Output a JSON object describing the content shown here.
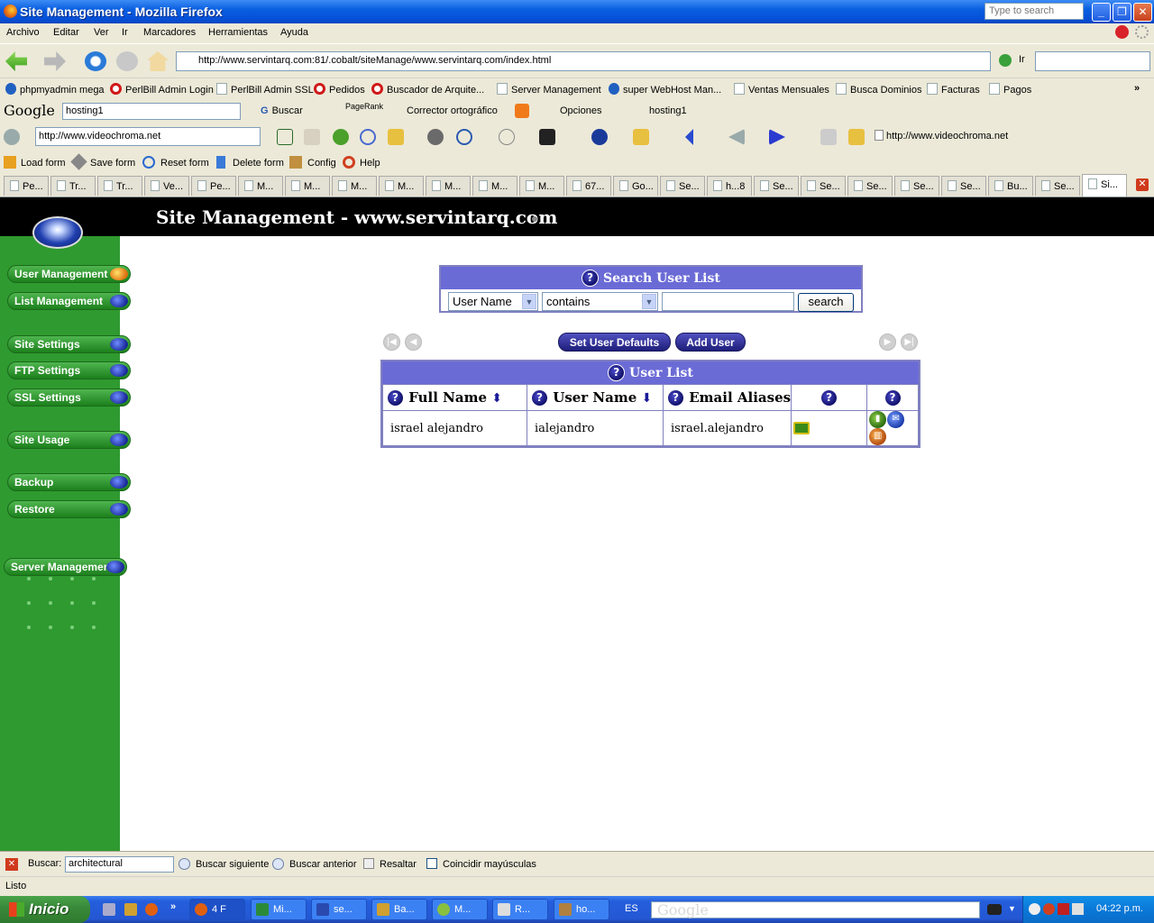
{
  "window": {
    "title": "Site Management - Mozilla Firefox",
    "search_placeholder": "Type to search"
  },
  "menubar": [
    "Archivo",
    "Editar",
    "Ver",
    "Ir",
    "Marcadores",
    "Herramientas",
    "Ayuda"
  ],
  "navbar": {
    "url": "http://www.servintarq.com:81/.cobalt/siteManage/www.servintarq.com/index.html",
    "go_label": "Ir"
  },
  "bookmarks": [
    "phpmyadmin mega",
    "PerlBill Admin Login",
    "PerlBill Admin SSL",
    "Pedidos",
    "Buscador de Arquite...",
    "Server Management",
    "super WebHost Man...",
    "Ventas Mensuales",
    "Busca Dominios",
    "Facturas",
    "Pagos"
  ],
  "googlebar": {
    "logo": "Google",
    "query": "hosting1",
    "search_label": "Buscar",
    "pagerank_label": "PageRank",
    "spell_label": "Corrector ortográfico",
    "options_label": "Opciones",
    "highlight_label": "hosting1"
  },
  "toolbar4": {
    "url": "http://www.videochroma.net",
    "url_display": "http://www.videochroma.net"
  },
  "formbar": [
    "Load form",
    "Save form",
    "Reset form",
    "Delete form",
    "Config",
    "Help"
  ],
  "tabs": [
    "Pe...",
    "Tr...",
    "Tr...",
    "Ve...",
    "Pe...",
    "M...",
    "M...",
    "M...",
    "M...",
    "M...",
    "M...",
    "M...",
    "67...",
    "Go...",
    "Se...",
    "h...8",
    "Se...",
    "Se...",
    "Se...",
    "Se...",
    "Se...",
    "Bu...",
    "Se...",
    "Si..."
  ],
  "page": {
    "header_title": "Site Management - www.servintarq.com",
    "sidebar": [
      {
        "label": "User Management",
        "active": true
      },
      {
        "label": "List Management",
        "active": false
      },
      {
        "label": "Site Settings",
        "active": false
      },
      {
        "label": "FTP Settings",
        "active": false
      },
      {
        "label": "SSL Settings",
        "active": false
      },
      {
        "label": "Site Usage",
        "active": false
      },
      {
        "label": "Backup",
        "active": false
      },
      {
        "label": "Restore",
        "active": false
      },
      {
        "label": "Server Management",
        "active": false
      }
    ],
    "search": {
      "title": "Search User List",
      "field": "User Name",
      "operator": "contains",
      "value": "",
      "button": "search"
    },
    "buttons": {
      "defaults": "Set User Defaults",
      "add": "Add User"
    },
    "user_list": {
      "title": "User List",
      "columns": [
        "Full Name",
        "User Name",
        "Email Aliases",
        "",
        ""
      ],
      "rows": [
        {
          "full_name": "israel alejandro",
          "user_name": "ialejandro",
          "email_aliases": "israel.alejandro"
        }
      ]
    }
  },
  "findbar": {
    "label": "Buscar:",
    "value": "architectural",
    "next": "Buscar siguiente",
    "prev": "Buscar anterior",
    "highlight": "Resaltar",
    "match_case": "Coincidir mayúsculas"
  },
  "status": "Listo",
  "taskbar": {
    "start": "Inicio",
    "tasks": [
      "4 F",
      "Mi...",
      "se...",
      "Ba...",
      "M...",
      "R...",
      "ho..."
    ],
    "lang": "ES",
    "google_band": "Google",
    "clock": "04:22 p.m."
  },
  "colors": {
    "sidebar": "#2f9a30",
    "panel_header": "#6b6bd6",
    "header": "#000000"
  }
}
